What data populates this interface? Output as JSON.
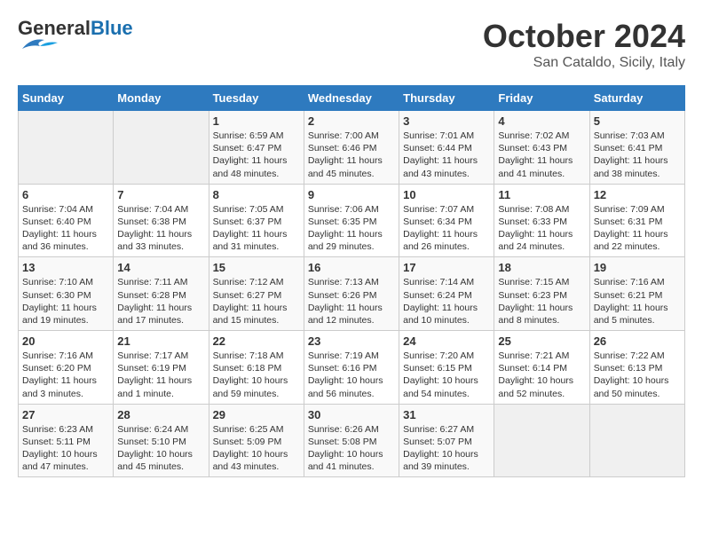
{
  "header": {
    "logo_general": "General",
    "logo_blue": "Blue",
    "month": "October 2024",
    "location": "San Cataldo, Sicily, Italy"
  },
  "weekdays": [
    "Sunday",
    "Monday",
    "Tuesday",
    "Wednesday",
    "Thursday",
    "Friday",
    "Saturday"
  ],
  "weeks": [
    [
      {
        "day": "",
        "info": ""
      },
      {
        "day": "",
        "info": ""
      },
      {
        "day": "1",
        "info": "Sunrise: 6:59 AM\nSunset: 6:47 PM\nDaylight: 11 hours and 48 minutes."
      },
      {
        "day": "2",
        "info": "Sunrise: 7:00 AM\nSunset: 6:46 PM\nDaylight: 11 hours and 45 minutes."
      },
      {
        "day": "3",
        "info": "Sunrise: 7:01 AM\nSunset: 6:44 PM\nDaylight: 11 hours and 43 minutes."
      },
      {
        "day": "4",
        "info": "Sunrise: 7:02 AM\nSunset: 6:43 PM\nDaylight: 11 hours and 41 minutes."
      },
      {
        "day": "5",
        "info": "Sunrise: 7:03 AM\nSunset: 6:41 PM\nDaylight: 11 hours and 38 minutes."
      }
    ],
    [
      {
        "day": "6",
        "info": "Sunrise: 7:04 AM\nSunset: 6:40 PM\nDaylight: 11 hours and 36 minutes."
      },
      {
        "day": "7",
        "info": "Sunrise: 7:04 AM\nSunset: 6:38 PM\nDaylight: 11 hours and 33 minutes."
      },
      {
        "day": "8",
        "info": "Sunrise: 7:05 AM\nSunset: 6:37 PM\nDaylight: 11 hours and 31 minutes."
      },
      {
        "day": "9",
        "info": "Sunrise: 7:06 AM\nSunset: 6:35 PM\nDaylight: 11 hours and 29 minutes."
      },
      {
        "day": "10",
        "info": "Sunrise: 7:07 AM\nSunset: 6:34 PM\nDaylight: 11 hours and 26 minutes."
      },
      {
        "day": "11",
        "info": "Sunrise: 7:08 AM\nSunset: 6:33 PM\nDaylight: 11 hours and 24 minutes."
      },
      {
        "day": "12",
        "info": "Sunrise: 7:09 AM\nSunset: 6:31 PM\nDaylight: 11 hours and 22 minutes."
      }
    ],
    [
      {
        "day": "13",
        "info": "Sunrise: 7:10 AM\nSunset: 6:30 PM\nDaylight: 11 hours and 19 minutes."
      },
      {
        "day": "14",
        "info": "Sunrise: 7:11 AM\nSunset: 6:28 PM\nDaylight: 11 hours and 17 minutes."
      },
      {
        "day": "15",
        "info": "Sunrise: 7:12 AM\nSunset: 6:27 PM\nDaylight: 11 hours and 15 minutes."
      },
      {
        "day": "16",
        "info": "Sunrise: 7:13 AM\nSunset: 6:26 PM\nDaylight: 11 hours and 12 minutes."
      },
      {
        "day": "17",
        "info": "Sunrise: 7:14 AM\nSunset: 6:24 PM\nDaylight: 11 hours and 10 minutes."
      },
      {
        "day": "18",
        "info": "Sunrise: 7:15 AM\nSunset: 6:23 PM\nDaylight: 11 hours and 8 minutes."
      },
      {
        "day": "19",
        "info": "Sunrise: 7:16 AM\nSunset: 6:21 PM\nDaylight: 11 hours and 5 minutes."
      }
    ],
    [
      {
        "day": "20",
        "info": "Sunrise: 7:16 AM\nSunset: 6:20 PM\nDaylight: 11 hours and 3 minutes."
      },
      {
        "day": "21",
        "info": "Sunrise: 7:17 AM\nSunset: 6:19 PM\nDaylight: 11 hours and 1 minute."
      },
      {
        "day": "22",
        "info": "Sunrise: 7:18 AM\nSunset: 6:18 PM\nDaylight: 10 hours and 59 minutes."
      },
      {
        "day": "23",
        "info": "Sunrise: 7:19 AM\nSunset: 6:16 PM\nDaylight: 10 hours and 56 minutes."
      },
      {
        "day": "24",
        "info": "Sunrise: 7:20 AM\nSunset: 6:15 PM\nDaylight: 10 hours and 54 minutes."
      },
      {
        "day": "25",
        "info": "Sunrise: 7:21 AM\nSunset: 6:14 PM\nDaylight: 10 hours and 52 minutes."
      },
      {
        "day": "26",
        "info": "Sunrise: 7:22 AM\nSunset: 6:13 PM\nDaylight: 10 hours and 50 minutes."
      }
    ],
    [
      {
        "day": "27",
        "info": "Sunrise: 6:23 AM\nSunset: 5:11 PM\nDaylight: 10 hours and 47 minutes."
      },
      {
        "day": "28",
        "info": "Sunrise: 6:24 AM\nSunset: 5:10 PM\nDaylight: 10 hours and 45 minutes."
      },
      {
        "day": "29",
        "info": "Sunrise: 6:25 AM\nSunset: 5:09 PM\nDaylight: 10 hours and 43 minutes."
      },
      {
        "day": "30",
        "info": "Sunrise: 6:26 AM\nSunset: 5:08 PM\nDaylight: 10 hours and 41 minutes."
      },
      {
        "day": "31",
        "info": "Sunrise: 6:27 AM\nSunset: 5:07 PM\nDaylight: 10 hours and 39 minutes."
      },
      {
        "day": "",
        "info": ""
      },
      {
        "day": "",
        "info": ""
      }
    ]
  ]
}
